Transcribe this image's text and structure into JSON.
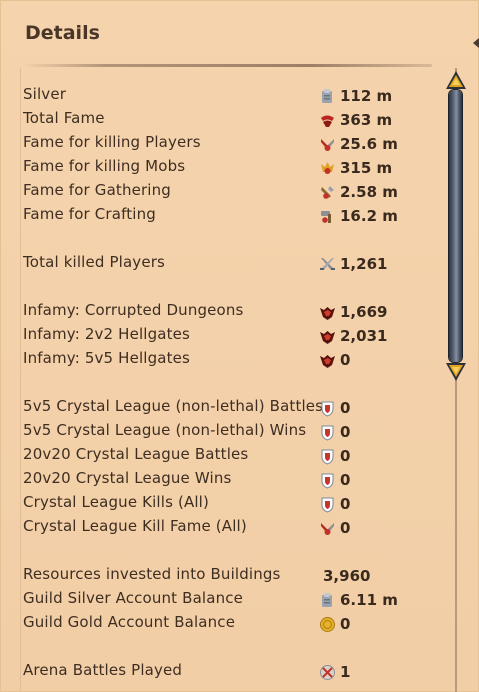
{
  "title": "Details",
  "stats": [
    {
      "label": "Silver",
      "value": "112 m",
      "icon": "silver-coin-icon"
    },
    {
      "label": "Total Fame",
      "value": "363 m",
      "icon": "fame-icon"
    },
    {
      "label": "Fame for killing Players",
      "value": "25.6 m",
      "icon": "pvp-fame-icon"
    },
    {
      "label": "Fame for killing Mobs",
      "value": "315 m",
      "icon": "pve-fame-icon"
    },
    {
      "label": "Fame for Gathering",
      "value": "2.58 m",
      "icon": "gathering-fame-icon"
    },
    {
      "label": "Fame for Crafting",
      "value": "16.2 m",
      "icon": "crafting-fame-icon"
    },
    {
      "label": "Total killed Players",
      "value": "1,261",
      "icon": "crossed-swords-icon"
    },
    {
      "label": "Infamy: Corrupted Dungeons",
      "value": "1,669",
      "icon": "infamy-icon"
    },
    {
      "label": "Infamy: 2v2 Hellgates",
      "value": "2,031",
      "icon": "infamy-icon"
    },
    {
      "label": "Infamy: 5v5 Hellgates",
      "value": "0",
      "icon": "infamy-icon"
    },
    {
      "label": "5v5 Crystal League (non-lethal) Battles",
      "value": "0",
      "icon": "crystal-shield-icon"
    },
    {
      "label": "5v5 Crystal League (non-lethal) Wins",
      "value": "0",
      "icon": "crystal-shield-icon"
    },
    {
      "label": "20v20 Crystal League Battles",
      "value": "0",
      "icon": "crystal-shield-icon"
    },
    {
      "label": "20v20 Crystal League Wins",
      "value": "0",
      "icon": "crystal-shield-icon"
    },
    {
      "label": "Crystal League Kills (All)",
      "value": "0",
      "icon": "crystal-shield-icon"
    },
    {
      "label": "Crystal League Kill Fame (All)",
      "value": "0",
      "icon": "pvp-fame-icon"
    },
    {
      "label": "Resources invested into Buildings",
      "value": "3,960",
      "icon": ""
    },
    {
      "label": "Guild Silver Account Balance",
      "value": "6.11 m",
      "icon": "silver-coin-icon"
    },
    {
      "label": "Guild Gold Account Balance",
      "value": "0",
      "icon": "gold-coin-icon"
    },
    {
      "label": "Arena Battles Played",
      "value": "1",
      "icon": "arena-icon"
    }
  ],
  "colors": {
    "panel_bg": "#f3d1aa",
    "text": "#3e2e22",
    "scroll_accent": "#e0a020"
  }
}
